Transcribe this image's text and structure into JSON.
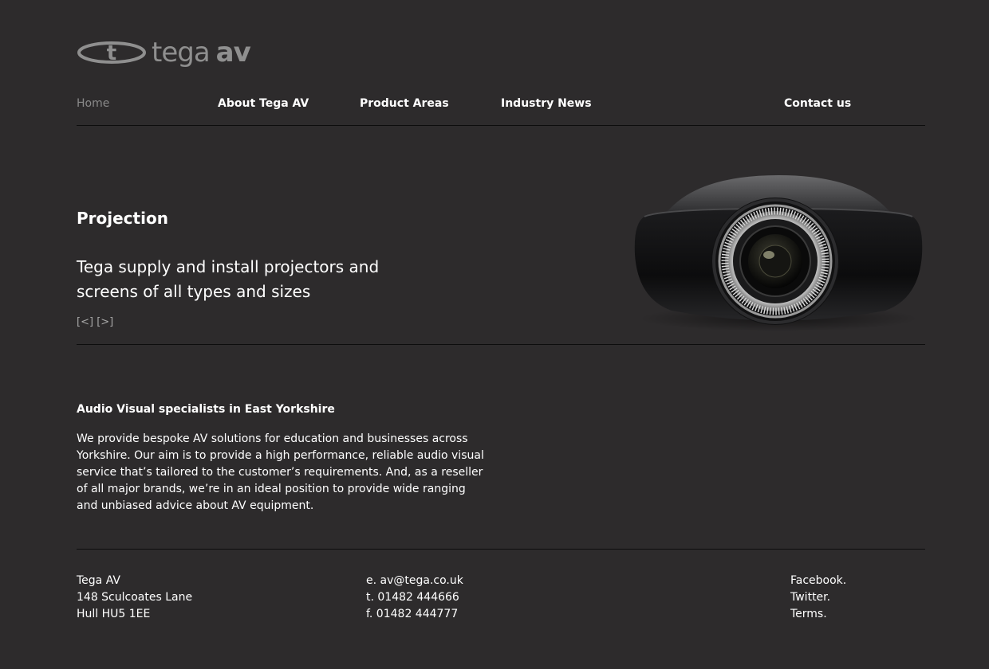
{
  "brand": {
    "logo_light": "tega",
    "logo_bold": "av",
    "logo_mark": "t"
  },
  "nav": {
    "items": [
      {
        "label": "Home",
        "active": true
      },
      {
        "label": "About Tega AV"
      },
      {
        "label": "Product Areas"
      },
      {
        "label": "Industry News"
      },
      {
        "label": "Contact us"
      }
    ]
  },
  "hero": {
    "title": "Projection",
    "text": "Tega supply and install projectors and screens of all types and sizes",
    "prev_label": "[<]",
    "next_label": "[>]"
  },
  "about": {
    "title": "Audio Visual specialists in East Yorkshire",
    "body": "We provide bespoke AV solutions for education and businesses across Yorkshire. Our aim is to provide a high performance, reliable audio visual service that’s tailored to the customer’s requirements. And, as a reseller of all major brands, we’re in an ideal position to provide wide ranging and unbiased advice about AV equipment."
  },
  "footer": {
    "address": [
      "Tega AV",
      "148 Sculcoates Lane",
      "Hull HU5 1EE"
    ],
    "contact": [
      "e. av@tega.co.uk",
      "t. 01482 444666",
      "f. 01482 444777"
    ],
    "links": [
      "Facebook.",
      "Twitter.",
      "Terms."
    ]
  },
  "colors": {
    "background": "#2d2b2c",
    "text": "#ffffff",
    "muted": "#8a8a8a",
    "rule": "#0d0d0d"
  },
  "icons": {
    "logo_mark": "tega-t-ellipse-logo",
    "hero_image": "projector-image"
  }
}
